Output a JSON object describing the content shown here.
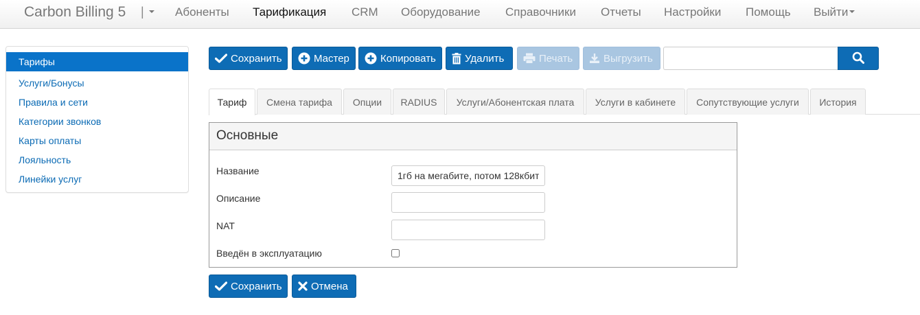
{
  "navbar": {
    "brand": "Carbon Billing 5",
    "brand_sep": "|",
    "items": [
      {
        "label": "Абоненты"
      },
      {
        "label": "Тарификация",
        "active": true
      },
      {
        "label": "CRM"
      },
      {
        "label": "Оборудование"
      },
      {
        "label": "Справочники"
      },
      {
        "label": "Отчеты"
      },
      {
        "label": "Настройки"
      },
      {
        "label": "Помощь"
      },
      {
        "label": "Выйти"
      }
    ]
  },
  "sidebar": {
    "items": [
      {
        "label": "Тарифы",
        "active": true
      },
      {
        "label": "Услуги/Бонусы"
      },
      {
        "label": "Правила и сети"
      },
      {
        "label": "Категории звонков"
      },
      {
        "label": "Карты оплаты"
      },
      {
        "label": "Лояльность"
      },
      {
        "label": "Линейки услуг"
      }
    ]
  },
  "toolbar": {
    "save": "Сохранить",
    "wizard": "Мастер",
    "copy": "Копировать",
    "delete": "Удалить",
    "print": "Печать",
    "export": "Выгрузить",
    "search_value": ""
  },
  "tabs": [
    {
      "label": "Тариф",
      "active": true
    },
    {
      "label": "Смена тарифа"
    },
    {
      "label": "Опции"
    },
    {
      "label": "RADIUS"
    },
    {
      "label": "Услуги/Абонентская плата"
    },
    {
      "label": "Услуги в кабинете"
    },
    {
      "label": "Сопутствующие услуги"
    },
    {
      "label": "История"
    }
  ],
  "panel": {
    "title": "Основные",
    "fields": {
      "name_label": "Название",
      "name_value": "1гб на мегабите, потом 128кбит",
      "description_label": "Описание",
      "description_value": "",
      "nat_label": "NAT",
      "nat_value": "",
      "in_operation_label": "Введён в эксплуатацию",
      "in_operation_checked": false
    }
  },
  "footer_buttons": {
    "save": "Сохранить",
    "cancel": "Отмена"
  },
  "colors": {
    "primary": "#0e6cb5",
    "sidebar_active": "#0a73c9",
    "link": "#0a6ab4",
    "disabled": "#a9c6e1"
  }
}
